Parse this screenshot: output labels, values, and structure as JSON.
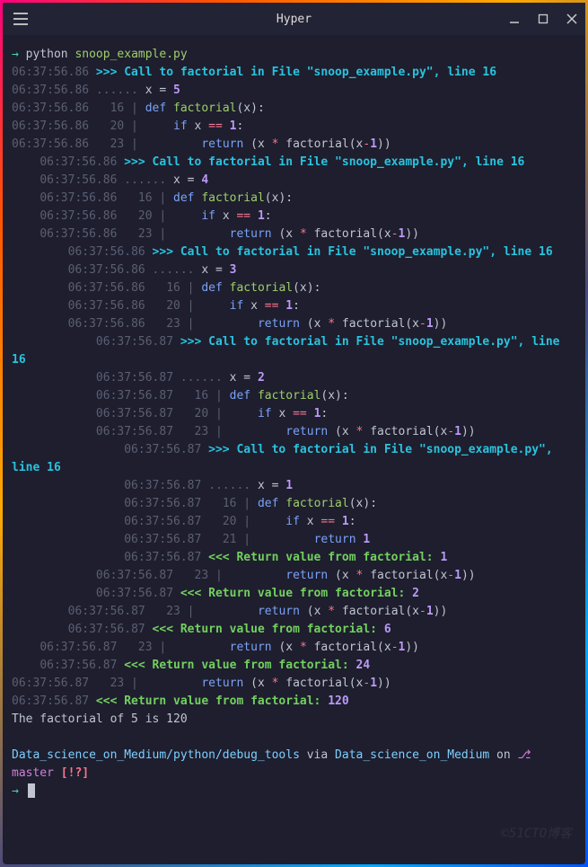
{
  "window": {
    "title": "Hyper"
  },
  "command_line": {
    "prompt_arrow": "→",
    "command": "python",
    "arg": "snoop_example.py"
  },
  "timestamps": {
    "t1": "06:37:56.86",
    "t2": "06:37:56.87"
  },
  "trace": {
    "call_prefix": ">>> Call to factorial in File ",
    "file_str": "\"snoop_example.py\"",
    "line_label": ", line ",
    "line_no": "16",
    "var_dots": "......",
    "var_x": "x",
    "eq": " = ",
    "def_kw": "def",
    "func_name": "factorial",
    "param": "(x)",
    "colon": ":",
    "if_kw": "if",
    "x_var": "x",
    "dbl_eq": "==",
    "one": "1",
    "return_kw": "return",
    "ret_body_pre": " (x ",
    "star": "*",
    "ret_body_mid": " factorial(x",
    "minus": "-",
    "ret_body_end": "))",
    "ret_prefix": "<<< Return value from factorial:",
    "ln16": "16",
    "ln20": "20",
    "ln21": "21",
    "ln23": "23",
    "pipe": " | ",
    "values": {
      "x5": "5",
      "x4": "4",
      "x3": "3",
      "x2": "2",
      "x1": "1",
      "r1": "1",
      "r2": "2",
      "r6": "6",
      "r24": "24",
      "r120": "120"
    }
  },
  "result_line": "The factorial of 5 is 120",
  "prompt_bottom": {
    "path": "Data_science_on_Medium/python/debug_tools",
    "via": " via ",
    "env": "Data_science_on_Medium",
    "on": " on ",
    "branch_icon": "⎇",
    "branch": "master",
    "status": " [!?]",
    "prompt_arrow": "→"
  },
  "watermark": "©51CTO博客"
}
